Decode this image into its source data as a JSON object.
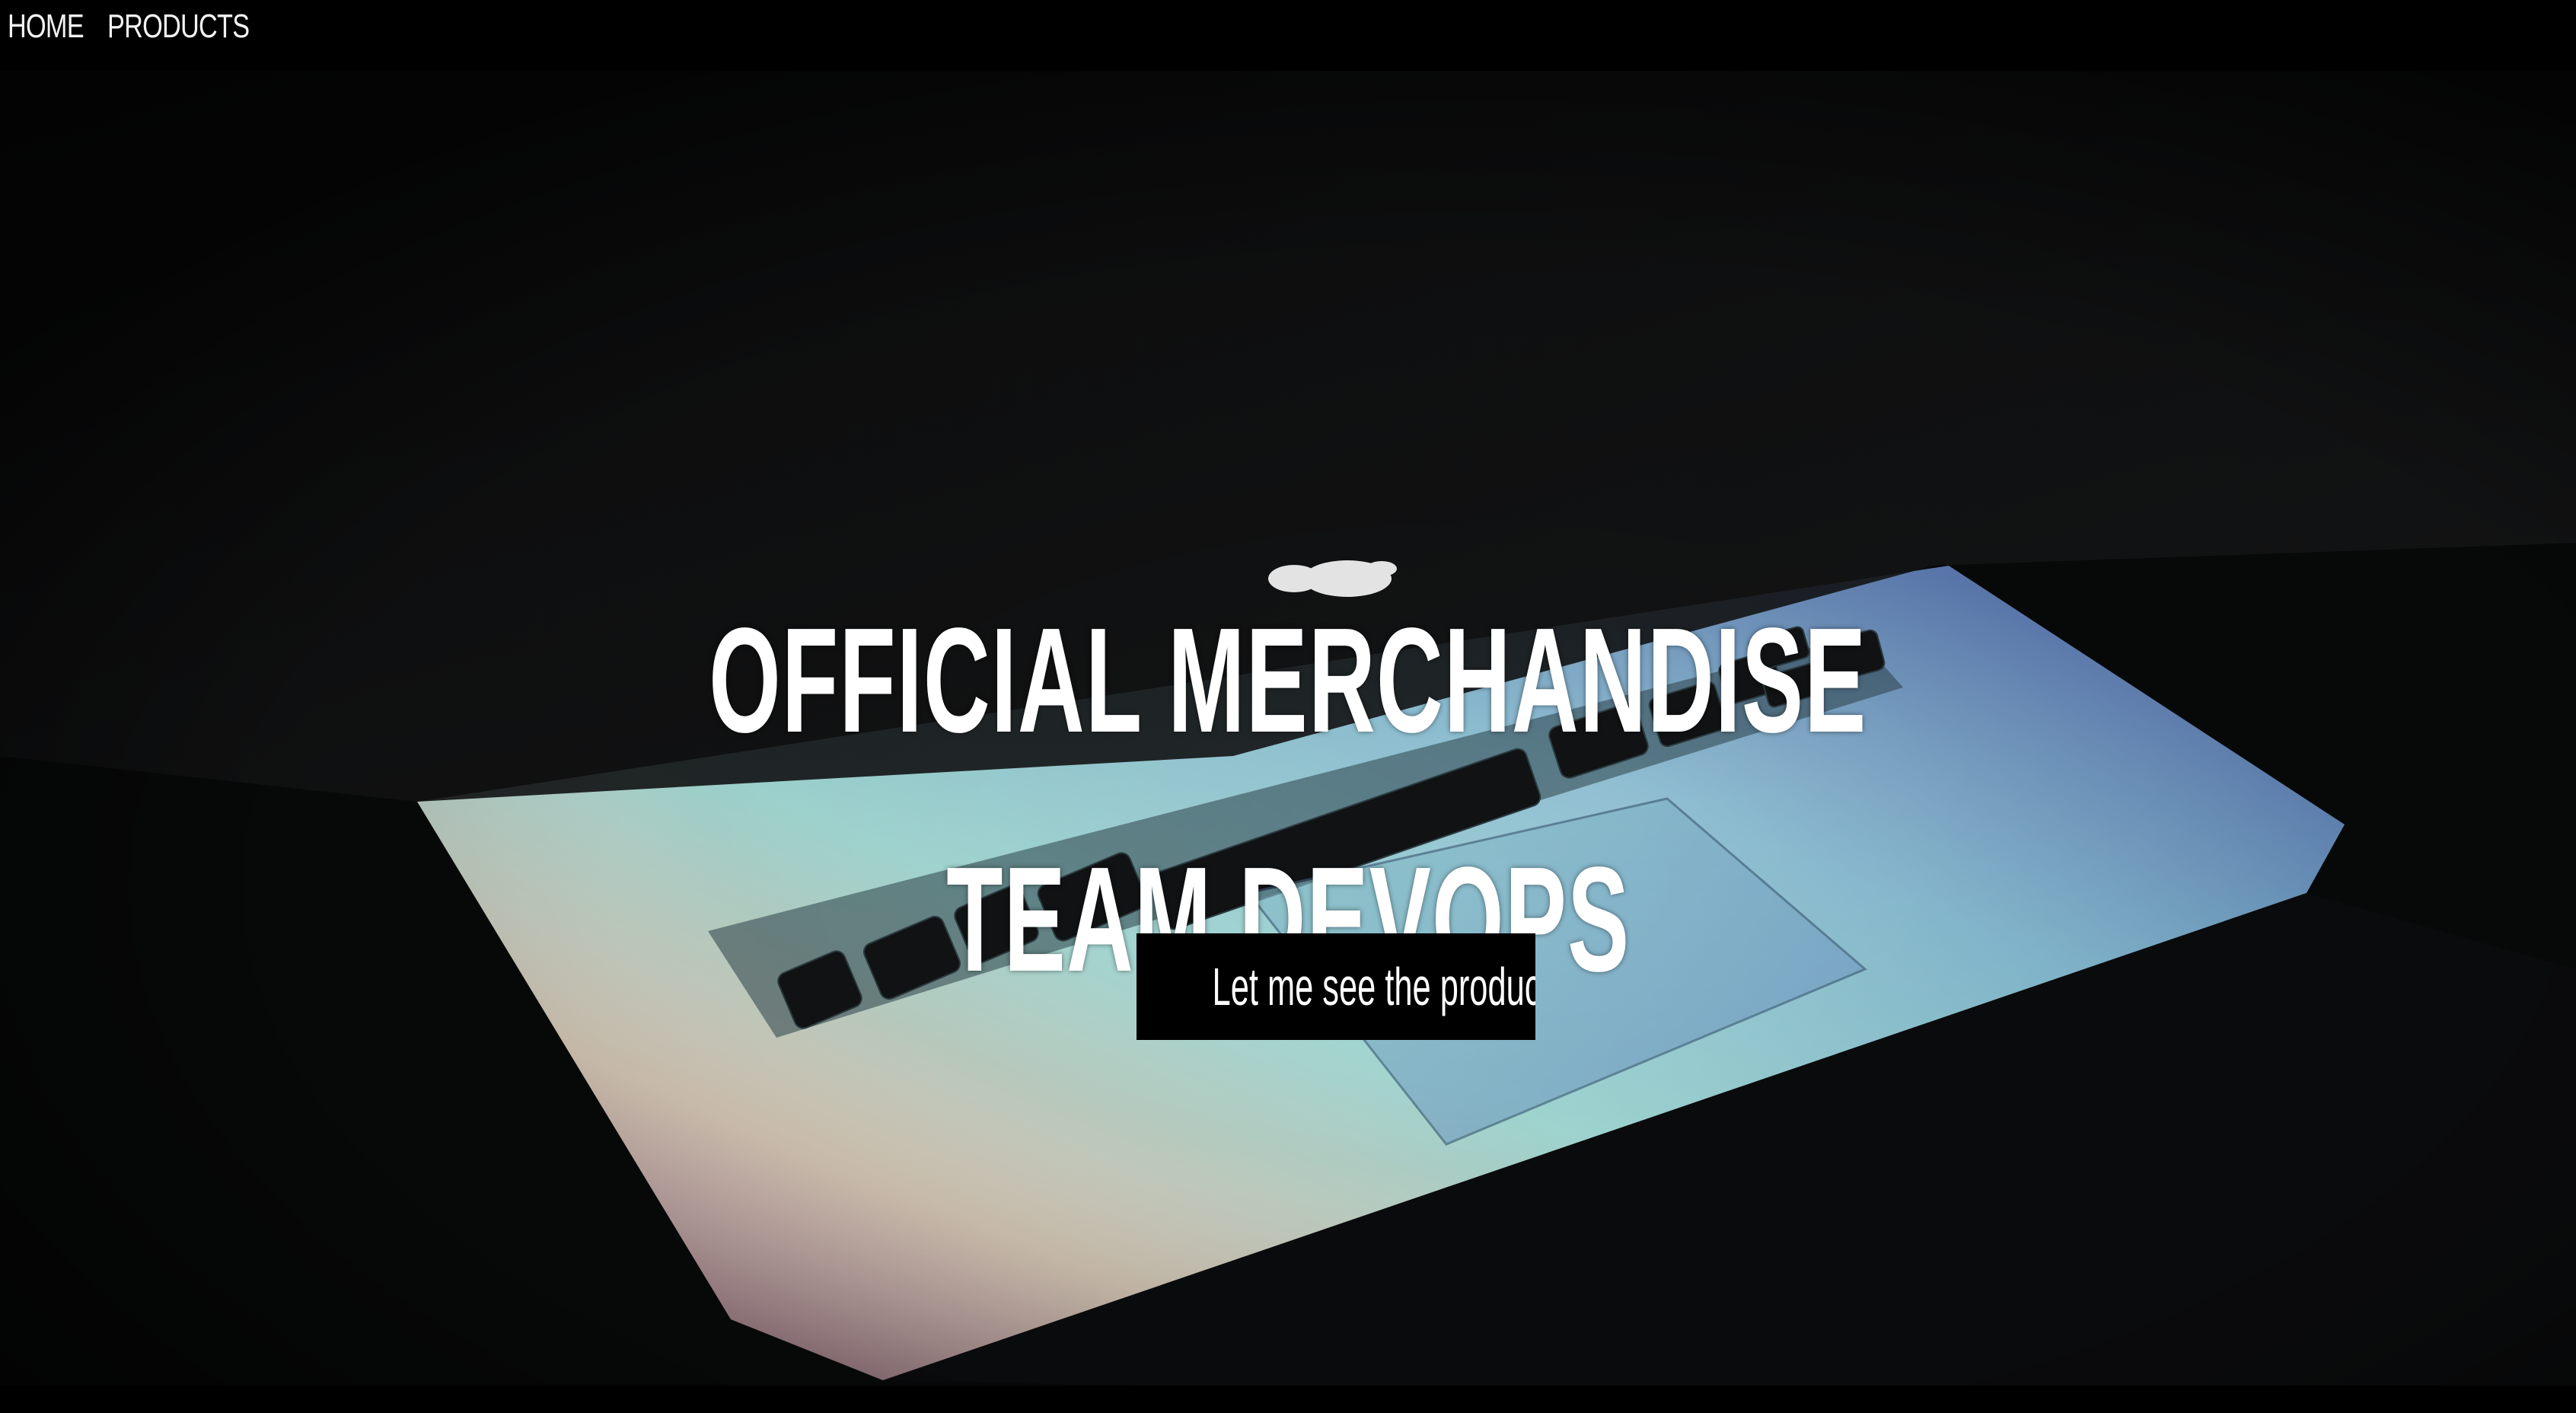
{
  "nav": {
    "items": [
      {
        "label": "HOME"
      },
      {
        "label": "PRODUCTS"
      }
    ]
  },
  "hero": {
    "title": "OFFICIAL MERCHANDISE",
    "subtitle": "TEAM DEVOPS",
    "cta_label": "Let me see the products",
    "background_description_icon": "laptop-photo"
  },
  "colors": {
    "nav_background": "#000000",
    "text": "#ffffff",
    "button_background": "#000000",
    "hero_background": "#070808"
  }
}
